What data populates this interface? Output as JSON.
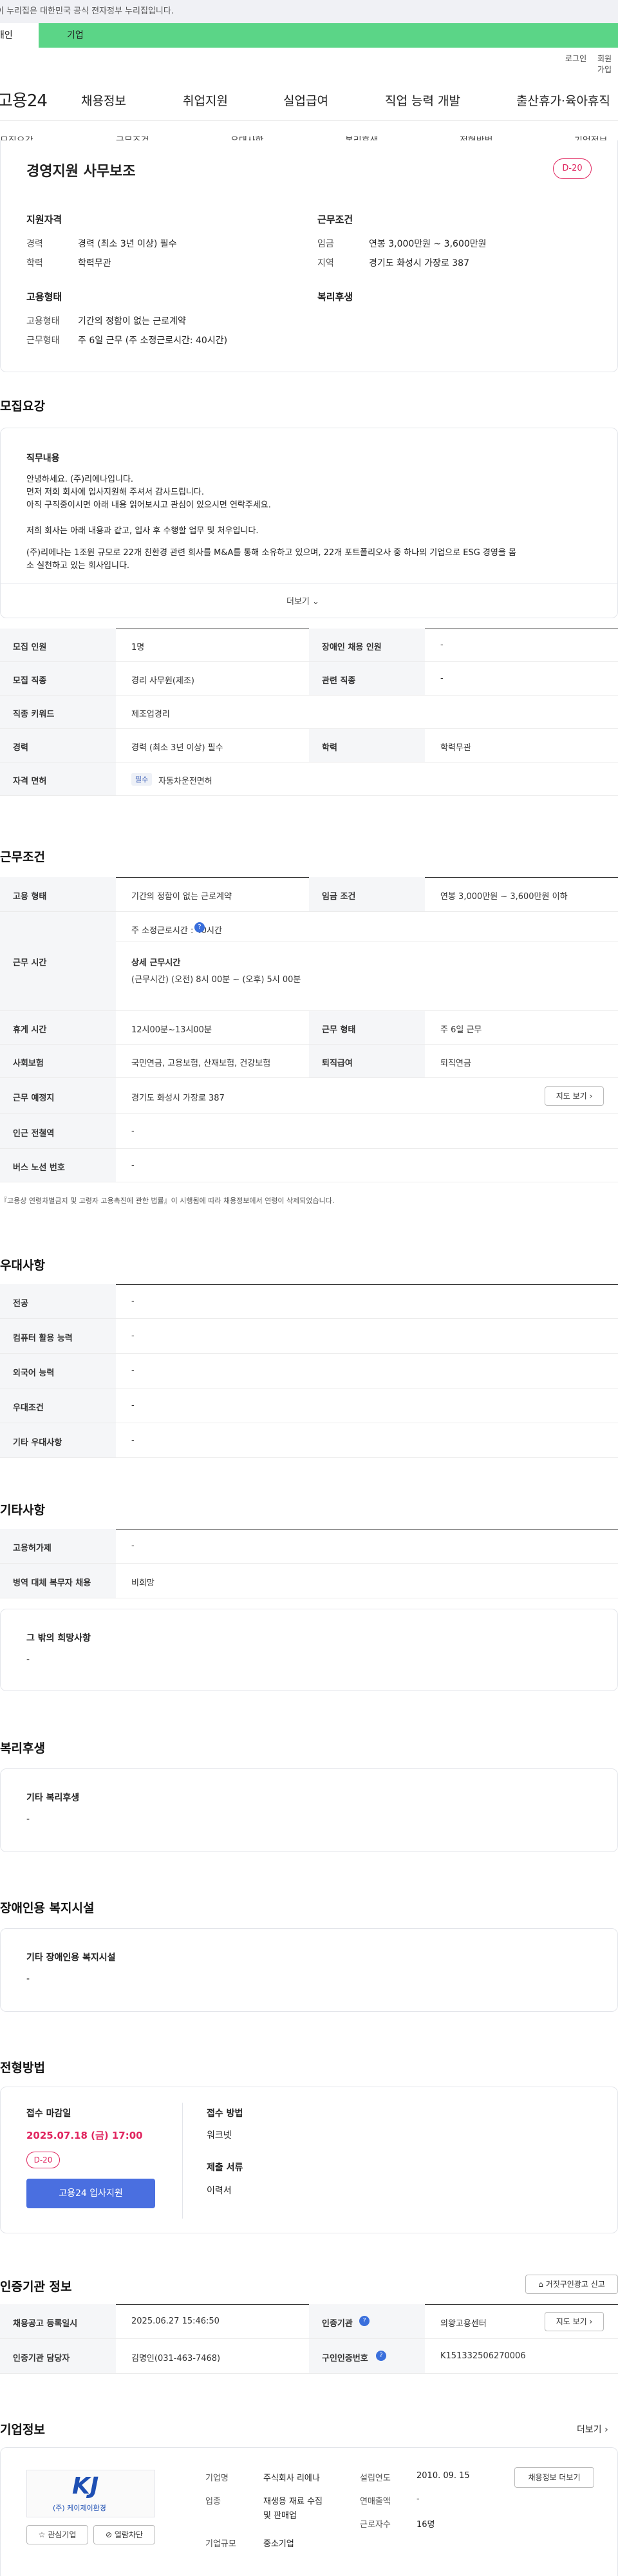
{
  "gov_banner": "이 누리집은 대한민국 공식 전자정부 누리집입니다.",
  "tabs": {
    "personal": "개인",
    "company": "기업"
  },
  "util": {
    "login": "로그인",
    "join": "회원가입"
  },
  "gnb": {
    "logo": "고용24",
    "items": [
      "채용정보",
      "취업지원",
      "실업급여",
      "직업 능력 개발",
      "출산휴가·육아휴직"
    ]
  },
  "snb": [
    "모집요강",
    "근무조건",
    "우대사항",
    "복리후생",
    "전형방법",
    "기업정보"
  ],
  "summary": {
    "title": "경영지원 사무보조",
    "dday": "D-20",
    "qual_title": "지원자격",
    "career_label": "경력",
    "career_value": "경력 (최소 3년 이상) 필수",
    "edu_label": "학력",
    "edu_value": "학력무관",
    "cond_title": "근무조건",
    "wage_label": "임금",
    "wage_value": "연봉 3,000만원 ~ 3,600만원",
    "region_label": "지역",
    "region_value": "경기도 화성시 가장로 387",
    "employ_title": "고용형태",
    "emptype_label": "고용형태",
    "emptype_value": "기간의 정함이 없는 근로계약",
    "worktype_label": "근무형태",
    "worktype_value": "주 6일 근무 (주 소정근로시간: 40시간)",
    "welfare_title": "복리후생"
  },
  "recruit": {
    "section": "모집요강",
    "duty_title": "직무내용",
    "lines": [
      "안녕하세요. (주)리에나입니다.",
      "먼저 저희 회사에 입사지원해 주셔서 감사드립니다.",
      "아직 구직중이시면 아래 내용 읽어보시고 관심이 있으시면 연락주세요.",
      "저희 회사는 아래 내용과 같고, 입사 후 수행할 업무 및 처우입니다.",
      "(주)리에나는 1조원 규모로 22개 친환경 관련 회사를 M&A를 통해 소유하고 있으며, 22개 포트폴리오사 중 하나의 기업으로 ESG 경영을 몸",
      "소 실천하고 있는 회사입니다."
    ],
    "more": "더보기",
    "table": {
      "headcount_label": "모집 인원",
      "headcount_value": "1명",
      "disabled_label": "장애인 채용 인원",
      "disabled_value": "-",
      "job_label": "모집 직종",
      "job_value": "경리 사무원(제조)",
      "related_label": "관련 직종",
      "related_value": "-",
      "keyword_label": "직종 키워드",
      "keyword_value": "제조업경리",
      "career_label": "경력",
      "career_value": "경력 (최소 3년 이상) 필수",
      "edu_label": "학력",
      "edu_value": "학력무관",
      "license_label": "자격 면허",
      "license_tag": "필수",
      "license_value": "자동차운전면허"
    }
  },
  "conditions": {
    "section": "근무조건",
    "emptype_label": "고용 형태",
    "emptype_value": "기간의 정함이 없는 근로계약",
    "wage_label": "임금 조건",
    "wage_value": "연봉 3,000만원 ~ 3,600만원 이하",
    "hours_label": "근무 시간",
    "hours_main": "주 소정근로시간 : 40시간",
    "hours_detail_title": "상세 근무시간",
    "hours_detail": "(근무시간) (오전) 8시 00분 ~ (오후) 5시 00분",
    "break_label": "휴게 시간",
    "break_value": "12시00분~13시00분",
    "worktype_label": "근무 형태",
    "worktype_value": "주 6일 근무",
    "insurance_label": "사회보험",
    "insurance_value": "국민연금, 고용보험, 산재보험, 건강보험",
    "retire_label": "퇴직급여",
    "retire_value": "퇴직연금",
    "place_label": "근무 예정지",
    "place_value": "경기도 화성시 가장로 387",
    "map_button": "지도 보기",
    "subway_label": "인근 전철역",
    "subway_value": "-",
    "bus_label": "버스 노선 번호",
    "bus_value": "-",
    "note": "『고용상 연령차별금지 및 고령자 고용촉진에 관한 법률』이 시행됨에 따라 채용정보에서 연령이 삭제되었습니다."
  },
  "preferred": {
    "section": "우대사항",
    "rows": [
      {
        "label": "전공",
        "value": "-"
      },
      {
        "label": "컴퓨터 활용 능력",
        "value": "-"
      },
      {
        "label": "외국어 능력",
        "value": "-"
      },
      {
        "label": "우대조건",
        "value": "-"
      },
      {
        "label": "기타 우대사항",
        "value": "-"
      }
    ]
  },
  "etc": {
    "section": "기타사항",
    "insurance_label": "고용허가제",
    "insurance_value": "-",
    "military_label": "병역 대체 복무자 채용",
    "military_value": "비희망",
    "wish_title": "그 밖의 희망사항",
    "wish_value": "-"
  },
  "welfare": {
    "section": "복리후생",
    "title": "기타 복리후생",
    "value": "-"
  },
  "facility": {
    "section": "장애인용 복지시설",
    "title": "기타 장애인용 복지시설",
    "value": "-"
  },
  "process": {
    "section": "전형방법",
    "deadline_label": "접수 마감일",
    "deadline_value": "2025.07.18 (금) 17:00",
    "dday": "D-20",
    "apply_button": "고용24 입사지원",
    "method_label": "접수 방법",
    "method_value": "워크넷",
    "docs_label": "제출 서류",
    "docs_value": "이력서"
  },
  "cert": {
    "section": "인증기관 정보",
    "report_button": "거짓구인광고 신고",
    "reg_label": "채용공고 등록일시",
    "reg_value": "2025.06.27 15:46:50",
    "org_label": "인증기관",
    "org_value": "의왕고용센터",
    "map_button": "지도 보기",
    "manager_label": "인증기관 담당자",
    "manager_value": "김명인(031-463-7468)",
    "number_label": "구인인증번호",
    "number_value": "K151332506270006"
  },
  "company": {
    "section": "기업정보",
    "more": "더보기",
    "logo_text": "KJ",
    "logo_sub": "(주) 케이제이환경",
    "interest_button": "관심기업",
    "block_button": "열람차단",
    "name_label": "기업명",
    "name_value": "주식회사 리에나",
    "biz_label": "업종",
    "biz_value_1": "재생용 재료 수집",
    "biz_value_2": "및 판매업",
    "size_label": "기업규모",
    "size_value": "중소기업",
    "founded_label": "설립연도",
    "founded_value": "2010. 09. 15",
    "revenue_label": "연매출액",
    "revenue_value": "-",
    "staff_label": "근로자수",
    "staff_value": "16명",
    "all_jobs_button": "채용정보 더보기"
  }
}
